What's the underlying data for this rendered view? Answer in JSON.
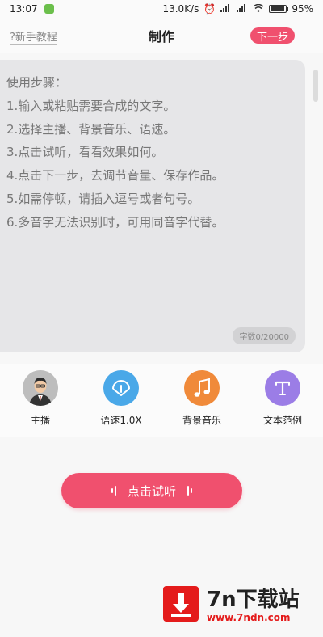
{
  "status_bar": {
    "time": "13:07",
    "network_speed": "13.0K/s",
    "battery": "95"
  },
  "header": {
    "tutorial_label": "新手教程",
    "tutorial_icon": "?",
    "title": "制作",
    "next_label": "下一步"
  },
  "editor": {
    "lines": [
      "使用步骤：",
      "1.输入或粘贴需要合成的文字。",
      "2.选择主播、背景音乐、语速。",
      "3.点击试听，看看效果如何。",
      "4.点击下一步，去调节音量、保存作品。",
      "5.如需停顿，请插入逗号或者句号。",
      "6.多音字无法识别时，可用同音字代替。"
    ],
    "char_count": "字数0/20000"
  },
  "tools": [
    {
      "label": "主播",
      "icon": "anchor-avatar-icon",
      "color": "#c9c9c9"
    },
    {
      "label": "语速1.0X",
      "icon": "speed-gauge-icon",
      "color": "#4aa8e8"
    },
    {
      "label": "背景音乐",
      "icon": "music-note-icon",
      "color": "#f08a3a"
    },
    {
      "label": "文本范例",
      "icon": "text-t-icon",
      "color": "#9b7de6"
    }
  ],
  "listen_button": {
    "label": "点击试听",
    "color": "#f0506e"
  },
  "watermark": {
    "title": "7n下载站",
    "url": "www.7ndn.com"
  }
}
